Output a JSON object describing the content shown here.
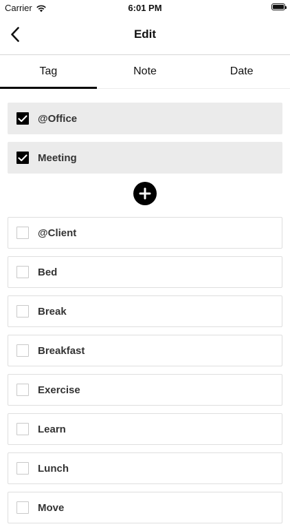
{
  "status": {
    "carrier": "Carrier",
    "time": "6:01 PM"
  },
  "nav": {
    "title": "Edit"
  },
  "tabs": [
    {
      "label": "Tag",
      "active": true
    },
    {
      "label": "Note",
      "active": false
    },
    {
      "label": "Date",
      "active": false
    }
  ],
  "selected_tags": [
    "@Office",
    "Meeting"
  ],
  "tags": [
    "@Client",
    "Bed",
    "Break",
    "Breakfast",
    "Exercise",
    "Learn",
    "Lunch",
    "Move"
  ]
}
